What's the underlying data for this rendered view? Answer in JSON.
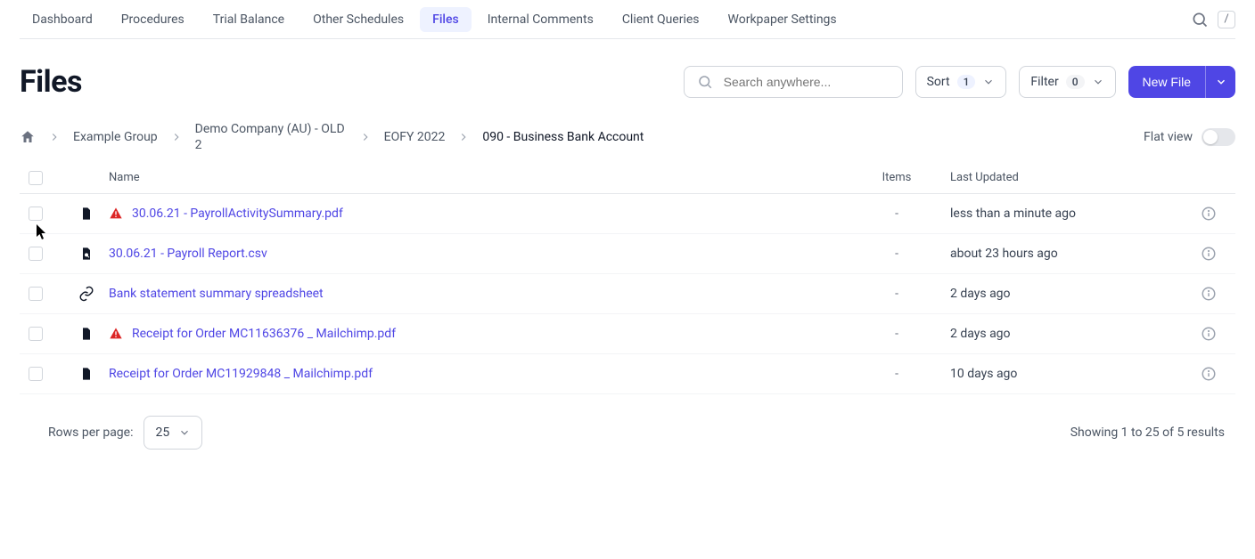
{
  "nav": {
    "tabs": [
      "Dashboard",
      "Procedures",
      "Trial Balance",
      "Other Schedules",
      "Files",
      "Internal Comments",
      "Client Queries",
      "Workpaper Settings"
    ],
    "active_index": 4,
    "kbd_shortcut": "/"
  },
  "header": {
    "title": "Files",
    "search_placeholder": "Search anywhere...",
    "sort_label": "Sort",
    "sort_count": "1",
    "filter_label": "Filter",
    "filter_count": "0",
    "new_file_label": "New File"
  },
  "breadcrumb": {
    "items": [
      "Example Group",
      "Demo Company (AU) - OLD 2",
      "EOFY 2022",
      "090 - Business Bank Account"
    ],
    "flat_view_label": "Flat view",
    "flat_view_on": false
  },
  "table": {
    "columns": {
      "name": "Name",
      "items": "Items",
      "last_updated": "Last Updated"
    },
    "rows": [
      {
        "icon": "file",
        "warning": true,
        "name": "30.06.21 - PayrollActivitySummary.pdf",
        "items": "-",
        "updated": "less than a minute ago"
      },
      {
        "icon": "file-search",
        "warning": false,
        "name": "30.06.21 - Payroll Report.csv",
        "items": "-",
        "updated": "about 23 hours ago"
      },
      {
        "icon": "link",
        "warning": false,
        "name": "Bank statement summary spreadsheet",
        "items": "-",
        "updated": "2 days ago"
      },
      {
        "icon": "file",
        "warning": true,
        "name": "Receipt for Order MC11636376 _ Mailchimp.pdf",
        "items": "-",
        "updated": "2 days ago"
      },
      {
        "icon": "file",
        "warning": false,
        "name": "Receipt for Order MC11929848 _ Mailchimp.pdf",
        "items": "-",
        "updated": "10 days ago"
      }
    ]
  },
  "footer": {
    "rows_per_page_label": "Rows per page:",
    "rows_per_page_value": "25",
    "showing_text": "Showing 1 to 25 of 5 results"
  }
}
